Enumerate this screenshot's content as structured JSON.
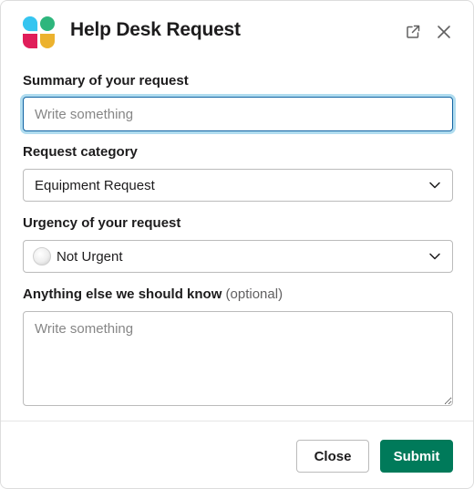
{
  "modal": {
    "title": "Help Desk Request",
    "header_icons": [
      "app-logo-icon",
      "popout-icon",
      "close-icon"
    ]
  },
  "form": {
    "summary": {
      "label": "Summary of your request",
      "placeholder": "Write something",
      "value": ""
    },
    "category": {
      "label": "Request category",
      "selected": "Equipment Request"
    },
    "urgency": {
      "label": "Urgency of your request",
      "selected": "Not Urgent",
      "indicator_icon": "white-circle-icon"
    },
    "notes": {
      "label": "Anything else we should know",
      "optional_label": "(optional)",
      "placeholder": "Write something"
    }
  },
  "footer": {
    "close_label": "Close",
    "submit_label": "Submit"
  },
  "colors": {
    "submit_green": "#007a5a",
    "focus_blue": "#1264a3",
    "logo_teal": "#36c5f0",
    "logo_green": "#2eb67d",
    "logo_pink": "#e01e5a",
    "logo_yellow": "#ecb22e"
  }
}
